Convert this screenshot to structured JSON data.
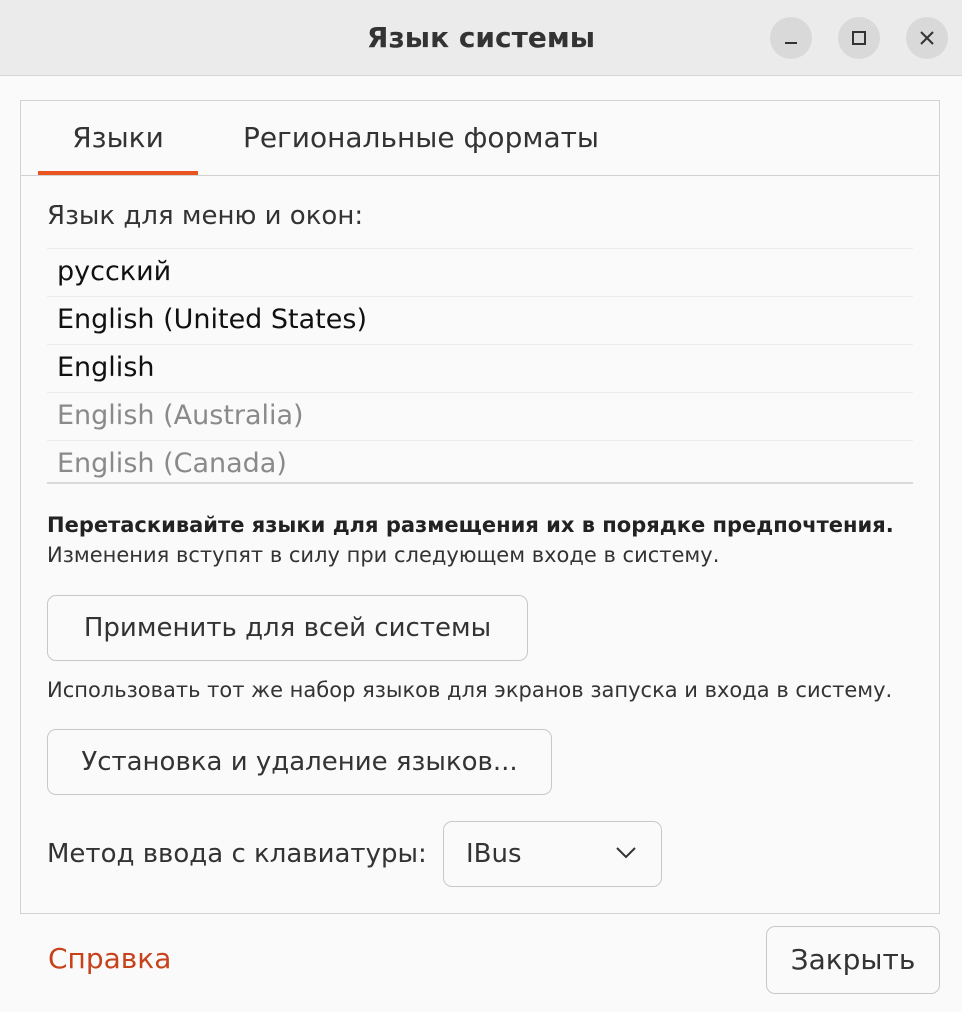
{
  "window": {
    "title": "Язык системы"
  },
  "tabs": [
    {
      "label": "Языки",
      "active": true
    },
    {
      "label": "Региональные форматы",
      "active": false
    }
  ],
  "languages_section": {
    "label": "Язык для меню и окон:",
    "items": [
      {
        "label": "русский",
        "dimmed": false
      },
      {
        "label": "English (United States)",
        "dimmed": false
      },
      {
        "label": "English",
        "dimmed": false
      },
      {
        "label": "English (Australia)",
        "dimmed": true
      },
      {
        "label": "English (Canada)",
        "dimmed": true
      }
    ],
    "hint_bold": "Перетаскивайте языки для размещения их в порядке предпочтения.",
    "hint_normal": "Изменения вступят в силу при следующем входе в систему."
  },
  "apply_button": {
    "label": "Применить для всей системы",
    "description": "Использовать тот же набор языков для экранов запуска и входа в систему."
  },
  "install_button": {
    "label": "Установка и удаление языков..."
  },
  "input_method": {
    "label": "Метод ввода с клавиатуры:",
    "value": "IBus"
  },
  "footer": {
    "help_label": "Справка",
    "close_label": "Закрыть"
  },
  "colors": {
    "accent": "#e95420",
    "link": "#c7411b"
  },
  "icons": {
    "minimize": "minimize-icon",
    "maximize": "maximize-icon",
    "close": "close-icon",
    "dropdown": "chevron-down-icon"
  }
}
